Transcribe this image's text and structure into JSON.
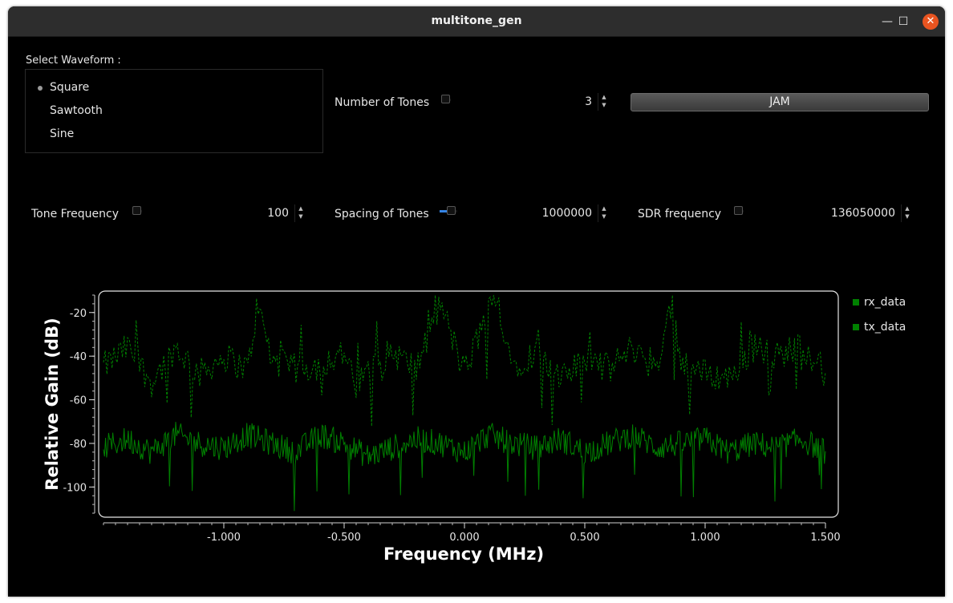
{
  "window": {
    "title": "multitone_gen"
  },
  "waveform": {
    "label": "Select Waveform :",
    "options": [
      "Square",
      "Sawtooth",
      "Sine"
    ],
    "selected": "Square"
  },
  "controls": {
    "num_tones": {
      "label": "Number of Tones",
      "value": "3",
      "slider_fraction": 0.02
    },
    "jam_button": {
      "label": "JAM"
    },
    "tone_freq": {
      "label": "Tone Frequency",
      "value": "100",
      "slider_fraction": 0.0
    },
    "spacing": {
      "label": "Spacing of Tones",
      "value": "1000000",
      "slider_fraction": 0.6
    },
    "sdr_freq": {
      "label": "SDR frequency",
      "value": "136050000",
      "slider_fraction": 0.0
    }
  },
  "icons": {
    "minimize": "minimize-icon",
    "maximize": "maximize-icon",
    "close": "close-icon",
    "spin": "spin-arrows-icon",
    "radio": "radio-dot-icon"
  },
  "colors": {
    "accent": "#3584e4",
    "series": "#008000",
    "close": "#e95420"
  },
  "chart_data": {
    "type": "line",
    "xlabel": "Frequency (MHz)",
    "ylabel": "Relative Gain (dB)",
    "xlim": [
      -1.5,
      1.5
    ],
    "ylim": [
      -112,
      -12
    ],
    "x_ticks": [
      -1.0,
      -0.5,
      0.0,
      0.5,
      1.0,
      1.5
    ],
    "x_tick_labels": [
      "-1.000",
      "-0.500",
      "0.000",
      "0.500",
      "1.000",
      "1.500"
    ],
    "y_ticks": [
      -20,
      -40,
      -60,
      -80,
      -100
    ],
    "y_tick_labels": [
      "-20",
      "-40",
      "-60",
      "-80",
      "-100"
    ],
    "legend": "right",
    "series": [
      {
        "name": "rx_data",
        "style": "dashed",
        "color": "#008000",
        "x": [
          -1.5,
          -1.4,
          -1.3,
          -1.2,
          -1.1,
          -1.0,
          -0.9,
          -0.86,
          -0.8,
          -0.7,
          -0.6,
          -0.5,
          -0.45,
          -0.4,
          -0.3,
          -0.2,
          -0.1,
          0.0,
          0.1,
          0.14,
          0.2,
          0.3,
          0.4,
          0.5,
          0.6,
          0.7,
          0.8,
          0.86,
          0.9,
          1.0,
          1.1,
          1.2,
          1.3,
          1.4,
          1.5
        ],
        "y": [
          -45,
          -36,
          -52,
          -36,
          -48,
          -40,
          -46,
          -16,
          -42,
          -46,
          -44,
          -38,
          -56,
          -46,
          -38,
          -46,
          -16,
          -48,
          -18,
          -16,
          -44,
          -38,
          -52,
          -40,
          -46,
          -36,
          -44,
          -16,
          -42,
          -48,
          -50,
          -36,
          -40,
          -34,
          -48
        ]
      },
      {
        "name": "tx_data",
        "style": "solid",
        "color": "#008000",
        "x": [
          -1.5,
          -1.4,
          -1.3,
          -1.2,
          -1.1,
          -1.0,
          -0.9,
          -0.8,
          -0.7,
          -0.6,
          -0.5,
          -0.4,
          -0.3,
          -0.2,
          -0.1,
          0.0,
          0.1,
          0.2,
          0.3,
          0.4,
          0.5,
          0.6,
          0.7,
          0.8,
          0.9,
          1.0,
          1.1,
          1.2,
          1.3,
          1.4,
          1.5
        ],
        "y": [
          -82,
          -78,
          -84,
          -76,
          -80,
          -82,
          -76,
          -80,
          -84,
          -76,
          -80,
          -86,
          -82,
          -78,
          -80,
          -84,
          -76,
          -80,
          -82,
          -78,
          -84,
          -80,
          -76,
          -82,
          -80,
          -78,
          -84,
          -80,
          -82,
          -78,
          -84
        ]
      }
    ]
  }
}
